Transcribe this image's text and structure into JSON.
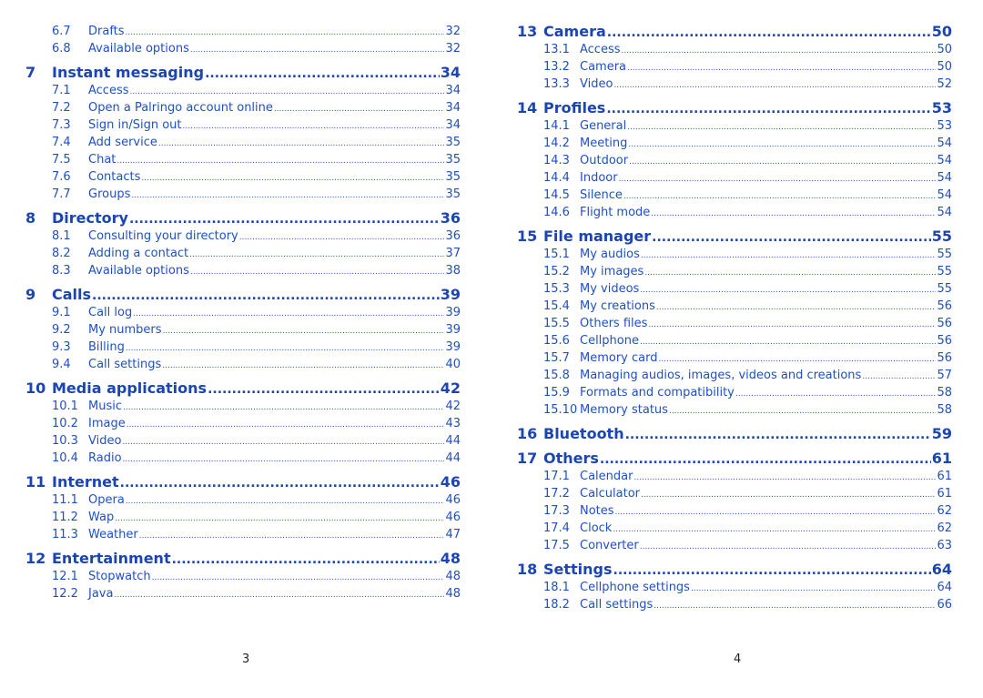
{
  "left": [
    {
      "level": "sub",
      "num": "6.7",
      "title": "Drafts",
      "page": "32"
    },
    {
      "level": "sub",
      "num": "6.8",
      "title": "Available options",
      "page": "32"
    },
    {
      "level": "chapter",
      "num": "7",
      "title": "Instant messaging",
      "page": "34"
    },
    {
      "level": "sub",
      "num": "7.1",
      "title": "Access",
      "page": "34"
    },
    {
      "level": "sub",
      "num": "7.2",
      "title": "Open a Palringo account online",
      "page": "34"
    },
    {
      "level": "sub",
      "num": "7.3",
      "title": "Sign in/Sign out",
      "page": "34"
    },
    {
      "level": "sub",
      "num": "7.4",
      "title": "Add service",
      "page": "35"
    },
    {
      "level": "sub",
      "num": "7.5",
      "title": "Chat",
      "page": "35"
    },
    {
      "level": "sub",
      "num": "7.6",
      "title": "Contacts",
      "page": "35"
    },
    {
      "level": "sub",
      "num": "7.7",
      "title": "Groups",
      "page": "35"
    },
    {
      "level": "chapter",
      "num": "8",
      "title": "Directory",
      "page": "36"
    },
    {
      "level": "sub",
      "num": "8.1",
      "title": "Consulting your directory",
      "page": "36"
    },
    {
      "level": "sub",
      "num": "8.2",
      "title": "Adding a contact",
      "page": "37"
    },
    {
      "level": "sub",
      "num": "8.3",
      "title": "Available options",
      "page": "38"
    },
    {
      "level": "chapter",
      "num": "9",
      "title": "Calls",
      "page": "39"
    },
    {
      "level": "sub",
      "num": "9.1",
      "title": "Call log",
      "page": "39"
    },
    {
      "level": "sub",
      "num": "9.2",
      "title": "My numbers",
      "page": "39"
    },
    {
      "level": "sub",
      "num": "9.3",
      "title": "Billing",
      "page": "39"
    },
    {
      "level": "sub",
      "num": "9.4",
      "title": "Call settings",
      "page": "40"
    },
    {
      "level": "chapter",
      "num": "10",
      "title": "Media applications",
      "page": "42"
    },
    {
      "level": "sub",
      "num": "10.1",
      "title": "Music",
      "page": "42"
    },
    {
      "level": "sub",
      "num": "10.2",
      "title": "Image",
      "page": "43"
    },
    {
      "level": "sub",
      "num": "10.3",
      "title": "Video",
      "page": "44"
    },
    {
      "level": "sub",
      "num": "10.4",
      "title": "Radio",
      "page": "44"
    },
    {
      "level": "chapter",
      "num": "11",
      "title": "Internet",
      "page": "46"
    },
    {
      "level": "sub",
      "num": "11.1",
      "title": "Opera",
      "page": "46"
    },
    {
      "level": "sub",
      "num": "11.2",
      "title": "Wap",
      "page": "46"
    },
    {
      "level": "sub",
      "num": "11.3",
      "title": "Weather",
      "page": "47"
    },
    {
      "level": "chapter",
      "num": "12",
      "title": "Entertainment",
      "page": "48"
    },
    {
      "level": "sub",
      "num": "12.1",
      "title": "Stopwatch",
      "page": "48"
    },
    {
      "level": "sub",
      "num": "12.2",
      "title": "Java",
      "page": "48"
    }
  ],
  "right": [
    {
      "level": "chapter",
      "num": "13",
      "title": "Camera",
      "page": "50"
    },
    {
      "level": "sub",
      "num": "13.1",
      "title": "Access",
      "page": "50"
    },
    {
      "level": "sub",
      "num": "13.2",
      "title": "Camera",
      "page": "50"
    },
    {
      "level": "sub",
      "num": "13.3",
      "title": "Video",
      "page": "52"
    },
    {
      "level": "chapter",
      "num": "14",
      "title": "Profiles",
      "page": "53"
    },
    {
      "level": "sub",
      "num": "14.1",
      "title": "General",
      "page": "53"
    },
    {
      "level": "sub",
      "num": "14.2",
      "title": "Meeting",
      "page": "54"
    },
    {
      "level": "sub",
      "num": "14.3",
      "title": "Outdoor",
      "page": "54"
    },
    {
      "level": "sub",
      "num": "14.4",
      "title": "Indoor",
      "page": "54"
    },
    {
      "level": "sub",
      "num": "14.5",
      "title": "Silence",
      "page": "54"
    },
    {
      "level": "sub",
      "num": "14.6",
      "title": "Flight mode",
      "page": "54"
    },
    {
      "level": "chapter",
      "num": "15",
      "title": "File manager",
      "page": "55"
    },
    {
      "level": "sub",
      "num": "15.1",
      "title": "My audios",
      "page": "55"
    },
    {
      "level": "sub",
      "num": "15.2",
      "title": "My images",
      "page": "55"
    },
    {
      "level": "sub",
      "num": "15.3",
      "title": "My videos",
      "page": "55"
    },
    {
      "level": "sub",
      "num": "15.4",
      "title": "My creations",
      "page": "56"
    },
    {
      "level": "sub",
      "num": "15.5",
      "title": "Others files",
      "page": "56"
    },
    {
      "level": "sub",
      "num": "15.6",
      "title": "Cellphone",
      "page": "56"
    },
    {
      "level": "sub",
      "num": "15.7",
      "title": "Memory card",
      "page": "56"
    },
    {
      "level": "sub",
      "num": "15.8",
      "title": "Managing audios, images, videos and creations",
      "page": "57"
    },
    {
      "level": "sub",
      "num": "15.9",
      "title": "Formats and compatibility",
      "page": "58"
    },
    {
      "level": "sub",
      "num": "15.10",
      "title": "Memory status",
      "page": "58"
    },
    {
      "level": "chapter",
      "num": "16",
      "title": "Bluetooth",
      "page": "59"
    },
    {
      "level": "chapter",
      "num": "17",
      "title": "Others",
      "page": "61"
    },
    {
      "level": "sub",
      "num": "17.1",
      "title": "Calendar",
      "page": "61"
    },
    {
      "level": "sub",
      "num": "17.2",
      "title": "Calculator",
      "page": "61"
    },
    {
      "level": "sub",
      "num": "17.3",
      "title": "Notes",
      "page": "62"
    },
    {
      "level": "sub",
      "num": "17.4",
      "title": "Clock",
      "page": "62"
    },
    {
      "level": "sub",
      "num": "17.5",
      "title": "Converter",
      "page": "63"
    },
    {
      "level": "chapter",
      "num": "18",
      "title": "Settings",
      "page": "64"
    },
    {
      "level": "sub",
      "num": "18.1",
      "title": "Cellphone settings",
      "page": "64"
    },
    {
      "level": "sub",
      "num": "18.2",
      "title": "Call settings",
      "page": "66"
    }
  ],
  "footer": {
    "left_page": "3",
    "right_page": "4"
  },
  "colors": {
    "text": "#1f4fc8",
    "chapter": "#1b45b5"
  }
}
